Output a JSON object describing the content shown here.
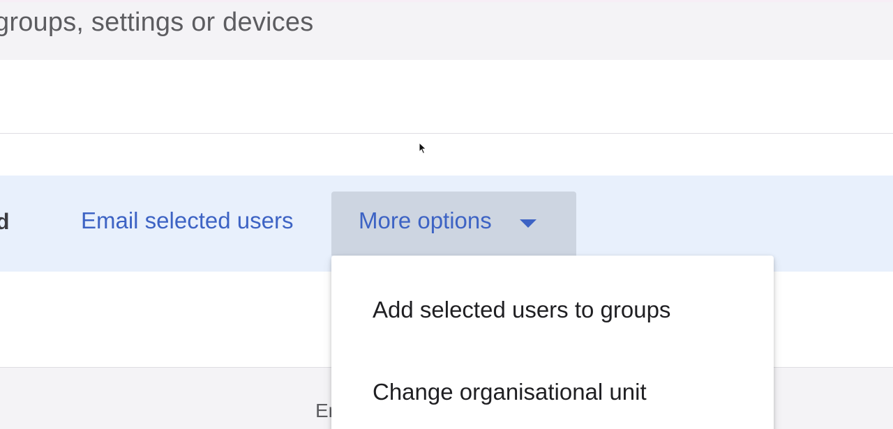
{
  "search": {
    "text": "groups, settings or devices"
  },
  "action_bar": {
    "partial_label": "d",
    "email_selected_users": "Email selected users",
    "more_options": "More options",
    "more_options_icon": "caret-down-icon"
  },
  "dropdown": {
    "items": [
      {
        "label": "Add selected users to groups"
      },
      {
        "label": "Change organisational unit"
      }
    ]
  },
  "footer": {
    "partial_text": "Er"
  },
  "colors": {
    "accent": "#3d63c4",
    "action_bar_bg": "#e8f0fc",
    "more_button_bg": "#cdd5e1"
  }
}
